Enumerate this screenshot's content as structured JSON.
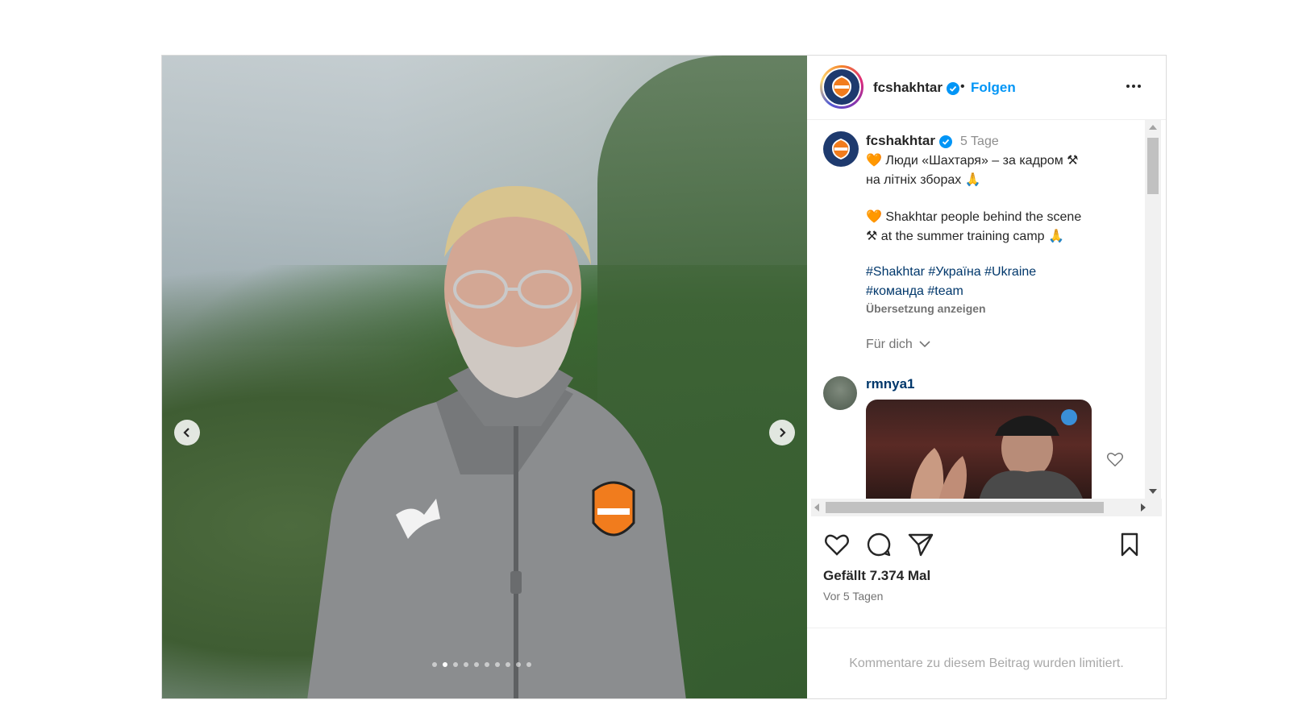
{
  "header": {
    "username": "fcshakhtar",
    "separator": "•",
    "follow_label": "Folgen"
  },
  "caption": {
    "username": "fcshakhtar",
    "time": "5 Tage",
    "line1": "🧡 Люди «Шахтаря» – за кадром ⚒",
    "line2": "на літніх зборах 🙏",
    "line3": "🧡 Shakhtar people behind the scene",
    "line4": "⚒ at the summer training camp 🙏",
    "hashtags_line1": "#Shakhtar #Україна #Ukraine",
    "hashtags_line2": "#команда #team",
    "translate_label": "Übersetzung anzeigen",
    "for_you_label": "Für dich"
  },
  "comment": {
    "username": "rmnya1"
  },
  "footer": {
    "likes": "Gefällt 7.374 Mal",
    "date": "Vor 5 Tagen",
    "comments_limited": "Kommentare zu diesem Beitrag wurden limitiert."
  },
  "carousel": {
    "total_slides": 10,
    "active_slide": 2
  },
  "colors": {
    "accent": "#0095f6",
    "hashtag": "#00376b",
    "muted": "#737373"
  },
  "icons": [
    "chevron-left-icon",
    "chevron-right-icon",
    "verified-icon",
    "more-icon",
    "heart-icon",
    "comment-icon",
    "share-icon",
    "bookmark-icon",
    "chevron-down-icon"
  ]
}
